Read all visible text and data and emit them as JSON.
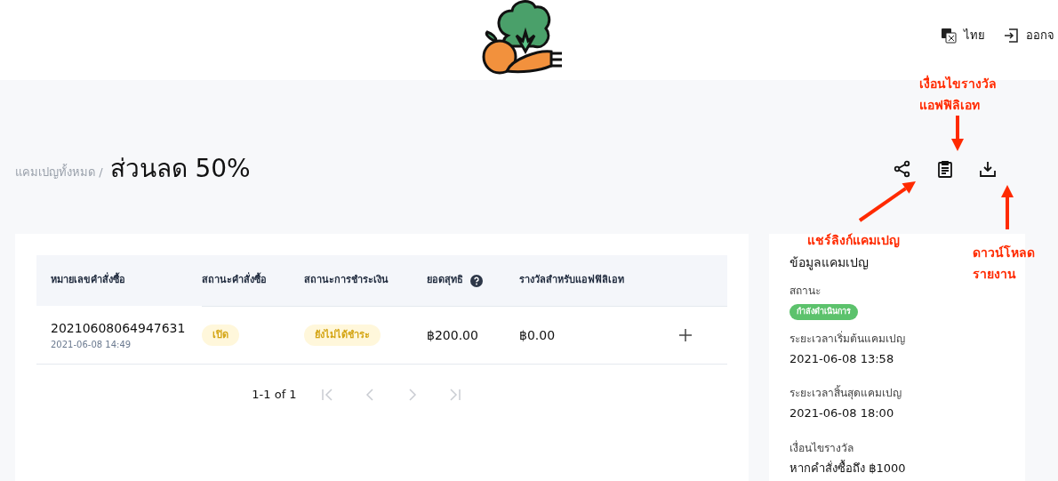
{
  "header": {
    "language": "ไทย",
    "logout": "ออกจ"
  },
  "breadcrumb": {
    "parent": "แคมเปญทั้งหมด /",
    "title": "ส่วนลด 50%"
  },
  "table": {
    "columns": [
      "หมายเลขคำสั่งซื้อ",
      "สถานะคำสั่งซื้อ",
      "สถานะการชำระเงิน",
      "ยอดสุทธิ",
      "รางวัลสำหรับแอฟฟิลิเอท"
    ],
    "rows": [
      {
        "order_no": "20210608064947631",
        "date": "2021-06-08 14:49",
        "order_status": "เปิด",
        "payment_status": "ยังไม่ได้ชำระ",
        "net": "฿200.00",
        "reward": "฿0.00",
        "expanded": false
      }
    ]
  },
  "pagination": {
    "range": "1-1 of 1",
    "buttons": [
      {
        "kind": "first",
        "disabled": true
      },
      {
        "kind": "prev",
        "disabled": true
      },
      {
        "kind": "next",
        "disabled": true
      },
      {
        "kind": "last",
        "disabled": true
      }
    ]
  },
  "info": {
    "title": "ข้อมูลแคมเปญ",
    "status_label": "สถานะ",
    "status": "กำลังดำเนินการ",
    "fields": [
      {
        "label": "ระยะเวลาเริ่มต้นแคมเปญ",
        "value": "2021-06-08 13:58"
      },
      {
        "label": "ระยะเวลาสิ้นสุดแคมเปญ",
        "value": "2021-06-08 18:00"
      },
      {
        "label": "เงื่อนไขรางวัล",
        "value": "หากคำสั่งซื้อถึง ฿1000"
      }
    ]
  },
  "annotations": [
    {
      "kind": "conditions",
      "lines": [
        "เงื่อนไขรางวัล",
        "แอฟฟิลิเอท"
      ]
    },
    {
      "kind": "share",
      "lines": [
        "แชร์ลิงก์แคมเปญ"
      ]
    },
    {
      "kind": "download",
      "lines": [
        "ดาวน์โหลด",
        "รายงาน"
      ]
    }
  ]
}
